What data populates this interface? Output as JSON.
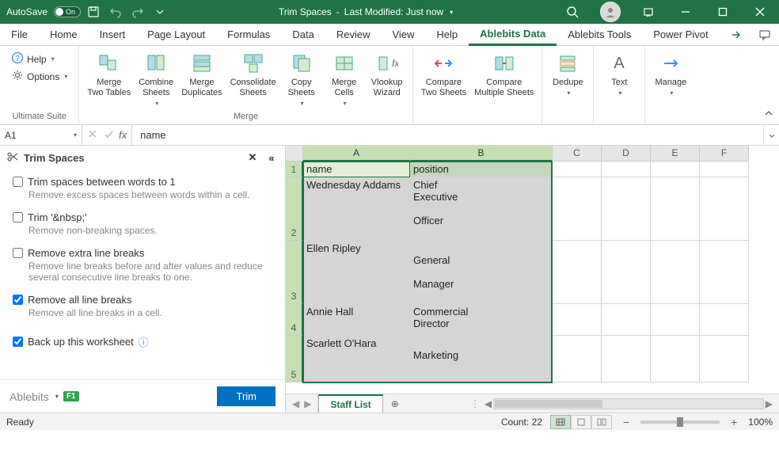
{
  "title_bar": {
    "autosave_label": "AutoSave",
    "autosave_state": "On",
    "doc_name": "Trim Spaces",
    "doc_status_sep": " - ",
    "doc_status": "Last Modified: Just now"
  },
  "ribbon_tabs": [
    "File",
    "Home",
    "Insert",
    "Page Layout",
    "Formulas",
    "Data",
    "Review",
    "View",
    "Help",
    "Ablebits Data",
    "Ablebits Tools",
    "Power Pivot"
  ],
  "ribbon_active_tab": "Ablebits Data",
  "ribbon_groups": {
    "ultimate_suite": {
      "label": "Ultimate Suite",
      "help": "Help",
      "options": "Options"
    },
    "merge": {
      "label": "Merge",
      "btns": [
        "Merge\nTwo Tables",
        "Combine\nSheets",
        "Merge\nDuplicates",
        "Consolidate\nSheets",
        "Copy\nSheets",
        "Merge\nCells",
        "Vlookup\nWizard"
      ]
    },
    "compare_a": "Compare\nTwo Sheets",
    "compare_b": "Compare\nMultiple Sheets",
    "dedupe": "Dedupe",
    "text": "Text",
    "manage": "Manage"
  },
  "formula_bar": {
    "name_box": "A1",
    "formula": "name"
  },
  "task_pane": {
    "title": "Trim Spaces",
    "options": [
      {
        "label": "Trim spaces between words to 1",
        "desc": "Remove excess spaces between words within a cell.",
        "checked": false
      },
      {
        "label": "Trim '&nbsp;'",
        "desc": "Remove non-breaking spaces.",
        "checked": false
      },
      {
        "label": "Remove extra line breaks",
        "desc": "Remove line breaks before and after values and reduce several consecutive line breaks to one.",
        "checked": false
      },
      {
        "label": "Remove all line breaks",
        "desc": "Remove all line breaks in a cell.",
        "checked": true
      }
    ],
    "backup": {
      "label": "Back up this worksheet",
      "checked": true
    },
    "brand": "Ablebits",
    "f1": "F1",
    "trim_btn": "Trim"
  },
  "sheet": {
    "columns": [
      "A",
      "B",
      "C",
      "D",
      "E",
      "F"
    ],
    "row_numbers": [
      "1",
      "2",
      "3",
      "4",
      "5"
    ],
    "headers": {
      "A": "name",
      "B": "position"
    },
    "data": [
      {
        "A": "Wednesday Addams",
        "B": "Chief\nExecutive\n\nOfficer"
      },
      {
        "A": "Ellen Ripley",
        "B": "\nGeneral\n\nManager"
      },
      {
        "A": "Annie Hall",
        "B": "Commercial\nDirector"
      },
      {
        "A": "Scarlett O'Hara",
        "B": "\nMarketing"
      }
    ],
    "active_sheet": "Staff List"
  },
  "status_bar": {
    "ready": "Ready",
    "count_label": "Count: ",
    "count_value": "22",
    "zoom": "100%"
  }
}
